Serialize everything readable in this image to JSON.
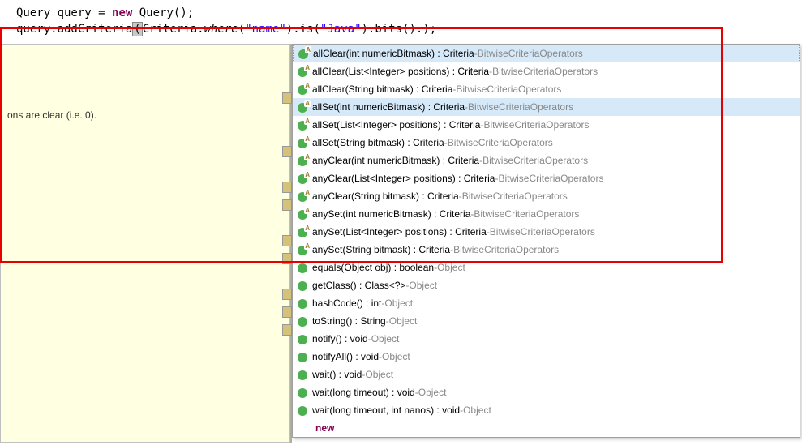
{
  "code": {
    "line1_pre": "Query query = ",
    "line1_new": "new",
    "line1_post": " Query();",
    "line2_pre": "query.addCriteria",
    "line2_open": "(",
    "line2_mid1": "Criteria.",
    "line2_where": "where",
    "line2_mid2": "(",
    "line2_str1": "\"name\"",
    "line2_mid3": ").is(",
    "line2_str2": "\"Java\"",
    "line2_mid4": ").bits().",
    "line2_end": ");"
  },
  "doc": {
    "text": "ons are clear (i.e. 0)."
  },
  "popup": {
    "items": [
      {
        "sig": "allClear(int numericBitmask) : Criteria",
        "from": "BitwiseCriteriaOperators",
        "abstract": true,
        "sel": true
      },
      {
        "sig": "allClear(List<Integer> positions) : Criteria",
        "from": "BitwiseCriteriaOperators",
        "abstract": true
      },
      {
        "sig": "allClear(String bitmask) : Criteria",
        "from": "BitwiseCriteriaOperators",
        "abstract": true
      },
      {
        "sig": "allSet(int numericBitmask) : Criteria",
        "from": "BitwiseCriteriaOperators",
        "abstract": true,
        "hov": true
      },
      {
        "sig": "allSet(List<Integer> positions) : Criteria",
        "from": "BitwiseCriteriaOperators",
        "abstract": true
      },
      {
        "sig": "allSet(String bitmask) : Criteria",
        "from": "BitwiseCriteriaOperators",
        "abstract": true
      },
      {
        "sig": "anyClear(int numericBitmask) : Criteria",
        "from": "BitwiseCriteriaOperators",
        "abstract": true
      },
      {
        "sig": "anyClear(List<Integer> positions) : Criteria",
        "from": "BitwiseCriteriaOperators",
        "abstract": true
      },
      {
        "sig": "anyClear(String bitmask) : Criteria",
        "from": "BitwiseCriteriaOperators",
        "abstract": true
      },
      {
        "sig": "anySet(int numericBitmask) : Criteria",
        "from": "BitwiseCriteriaOperators",
        "abstract": true
      },
      {
        "sig": "anySet(List<Integer> positions) : Criteria",
        "from": "BitwiseCriteriaOperators",
        "abstract": true
      },
      {
        "sig": "anySet(String bitmask) : Criteria",
        "from": "BitwiseCriteriaOperators",
        "abstract": true
      },
      {
        "sig": "equals(Object obj) : boolean",
        "from": "Object",
        "abstract": false
      },
      {
        "sig": "getClass() : Class<?>",
        "from": "Object",
        "abstract": false
      },
      {
        "sig": "hashCode() : int",
        "from": "Object",
        "abstract": false
      },
      {
        "sig": "toString() : String",
        "from": "Object",
        "abstract": false
      },
      {
        "sig": "notify() : void",
        "from": "Object",
        "abstract": false
      },
      {
        "sig": "notifyAll() : void",
        "from": "Object",
        "abstract": false
      },
      {
        "sig": "wait() : void",
        "from": "Object",
        "abstract": false
      },
      {
        "sig": "wait(long timeout) : void",
        "from": "Object",
        "abstract": false
      },
      {
        "sig": "wait(long timeout, int nanos) : void",
        "from": "Object",
        "abstract": false
      }
    ],
    "new_kw": "new"
  }
}
